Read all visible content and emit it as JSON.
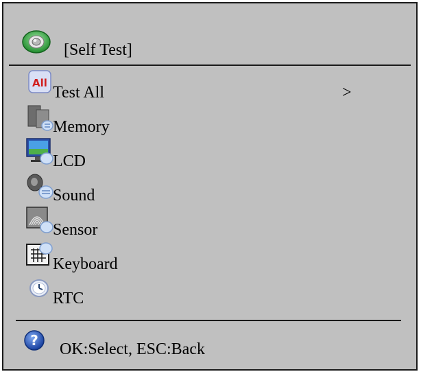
{
  "header": {
    "title": "[Self Test]",
    "icon": "green-gear-icon"
  },
  "menu": {
    "items": [
      {
        "label": "Test All",
        "icon": "all-icon",
        "submenu_indicator": ">"
      },
      {
        "label": "Memory",
        "icon": "memory-icon"
      },
      {
        "label": "LCD",
        "icon": "lcd-icon"
      },
      {
        "label": "Sound",
        "icon": "speaker-icon"
      },
      {
        "label": "Sensor",
        "icon": "fingerprint-sensor-icon"
      },
      {
        "label": "Keyboard",
        "icon": "keyboard-icon"
      },
      {
        "label": "RTC",
        "icon": "clock-icon"
      }
    ]
  },
  "footer": {
    "hint": "OK:Select, ESC:Back",
    "icon": "help-icon"
  },
  "colors": {
    "background": "#c0c0c0",
    "border": "#1a1a1a",
    "text": "#000000",
    "accent_green": "#2e9d3a",
    "help_blue": "#1f4fb5"
  }
}
